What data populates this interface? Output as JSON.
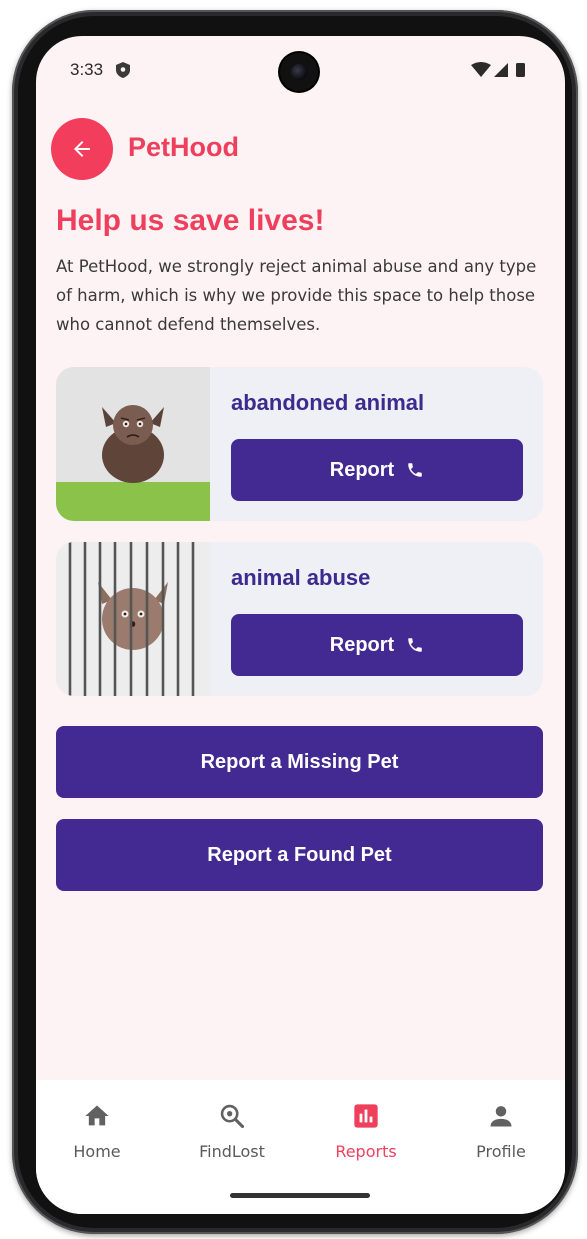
{
  "status_bar": {
    "time": "3:33"
  },
  "header": {
    "app_title": "PetHood"
  },
  "main": {
    "headline": "Help us save lives!",
    "intro": "At PetHood, we strongly reject animal abuse and any type of harm, which is why we provide this space to help those who cannot defend themselves.",
    "cards": [
      {
        "title": "abandoned animal",
        "button_label": "Report"
      },
      {
        "title": "animal abuse",
        "button_label": "Report"
      }
    ],
    "report_missing_label": "Report a Missing Pet",
    "report_found_label": "Report a Found Pet"
  },
  "bottom_nav": {
    "items": [
      {
        "label": "Home",
        "icon": "home-icon"
      },
      {
        "label": "FindLost",
        "icon": "search-pet-icon"
      },
      {
        "label": "Reports",
        "icon": "bar-chart-icon",
        "active": true
      },
      {
        "label": "Profile",
        "icon": "person-icon"
      }
    ]
  },
  "colors": {
    "accent": "#ee3f5d",
    "primary": "#432a93",
    "background": "#fdf2f4",
    "card": "#eff0f5"
  }
}
